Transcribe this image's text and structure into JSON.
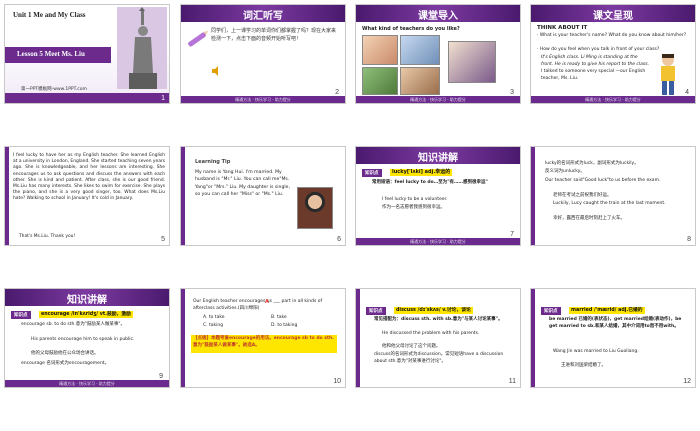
{
  "slides": [
    {
      "num": "1",
      "unit": "Unit 1    Me and My Class",
      "lesson": "Lesson 5   Meet Ms. Liu",
      "site": "第一PPT模板网-www.1PPT.com"
    },
    {
      "num": "2",
      "title": "词汇听写",
      "body": "同学们，上一课学习的单词你们都掌握了吗？现在大家来检测一下，点击下面的音频开始听写吧！"
    },
    {
      "num": "3",
      "title": "课堂导入",
      "question": "What kind of teachers do you like?"
    },
    {
      "num": "4",
      "title": "课文呈现",
      "heading": "THINK ABOUT IT",
      "lines": [
        "· What is your teacher's name? What do you know about him/her?",
        "· How do you feel when you talk in front of your class?",
        "It's English class. Li Ming is standing at the front. He is ready to give his report to the class.",
        "I talked to someone very special —our English teacher, Ms. Liu."
      ]
    },
    {
      "num": "5",
      "body": "I feel lucky to have her as my English teacher. She learned English at a university in London, England. She started teaching seven years ago. She is knowledgeable, and her lessons are interesting. She encourages us to ask questions and discuss the answers with each other. She is kind and patient. After class, she is our good friend. Ms.Liu has many interests. She likes to swim for exercise. She plays the piano, and she is a very good singer, too. What does Ms.Liu hate? Walking to school in January! It's cold in January.",
      "end": "That's Ms.Liu. Thank you!"
    },
    {
      "num": "6",
      "tip": "Learning Tip",
      "body": "My name is Yang Hui. I'm married. My husband is \"Mr.\" Liu. You can call me\"Ms. Yang\"or \"Mrs.\" Liu. My daughter is single, so you can call her \"Miss\" or \"Ms.\" Liu."
    },
    {
      "num": "7",
      "title": "知识讲解",
      "point": "知识点",
      "item": "lucky['lʌki] adj.幸运的",
      "l1": "常用短语：feel lucky to do…至为\"有……感到很幸运\"",
      "eg": "I feel lucky to be a volunteer.",
      "cn": "作为一名志愿者我感到很幸运。"
    },
    {
      "num": "8",
      "l1": "lucky的名词形式为luck，副词形式为luckily。",
      "l2": "反义词为unlucky。",
      "eg1": "Our teacher said\"Good luck\"to us before the exam.",
      "cn1": "老师在考试之前祝我们好运。",
      "eg2": "Luckily, Lucy caught the train at the last moment.",
      "cn2": "幸好，露西在最后时刻赶上了火车。"
    },
    {
      "num": "9",
      "title": "知识讲解",
      "point": "知识点",
      "item": "encourage /in'kʌridʒ/ vt.鼓励，激励",
      "l1": "encourage sb. to do sth.意为\"鼓励某人做某事\"。",
      "eg": "His parents encourage him to speak in public.",
      "cn": "他的父母鼓励他在公众场合讲话。",
      "ext": "encourage 名词形式为encouragement。"
    },
    {
      "num": "10",
      "q": "Our English teacher encourages us ___ part in all kinds of afterclass activities.(四川绵阳)",
      "opts": [
        "A. to take",
        "B. take",
        "C. taking",
        "D. to taking"
      ],
      "ans": "A",
      "note": "【点拨】本题考查encourage的用法。encourage sb to do sth.意为\"鼓励某人做某事\"。故选A。"
    },
    {
      "num": "11",
      "title": "知识讲解",
      "point": "知识点",
      "item": "discuss /dɪ'skʌs/ v.讨论，谈论",
      "l1": "常见搭配为：discuss sth. with sb.意为\"与某人讨论某事\"。",
      "eg": "He discussed the problem with his parents.",
      "cn": "他和他父母讨论了这个问题。",
      "ext": "discuss的名词形式为discussion。常见短语have a discussion about sth.意为\"对某事进行讨论\"。"
    },
    {
      "num": "12",
      "point": "知识点",
      "item": "married /'mærid/ adj.已婚的",
      "l1": "be married 已婚的(表状态)，get married结婚(表动作)，be get married to sb.和某人结婚，其中介词用to而不用with。",
      "eg": "Wang Jin was married to Liu Guoliang.",
      "cn": "王进和刘国梁结婚了。"
    }
  ],
  "footer_text": "精通方法 · 快乐学习 · 助力提分",
  "badge_text": "课件素材 · 第一PPT",
  "colors": {
    "purple": "#6b2a8c",
    "accent_red": "#e4322b",
    "highlight": "#ffe600"
  }
}
